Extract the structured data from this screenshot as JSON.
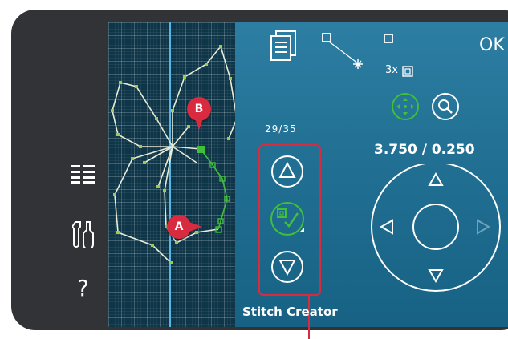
{
  "sidebar": {
    "items": [
      {
        "icon": "menu-list-icon"
      },
      {
        "icon": "tools-settings-icon"
      },
      {
        "icon": "help-icon",
        "label": "?"
      }
    ]
  },
  "header": {
    "ok_label": "OK",
    "duplicate_label": "3x"
  },
  "edit": {
    "counter": "29/35",
    "coordinates": "3.750 / 0.250",
    "title": "Stitch Creator"
  },
  "markers": {
    "a": "A",
    "b": "B"
  },
  "colors": {
    "screen_blue": "#2c7ea2",
    "grid_dark": "#0e3548",
    "stitch_line": "#e8ecd8",
    "stitch_point": "#9ccd4a",
    "selected_green": "#3fbf3a",
    "highlight_red": "#d92b3f"
  }
}
